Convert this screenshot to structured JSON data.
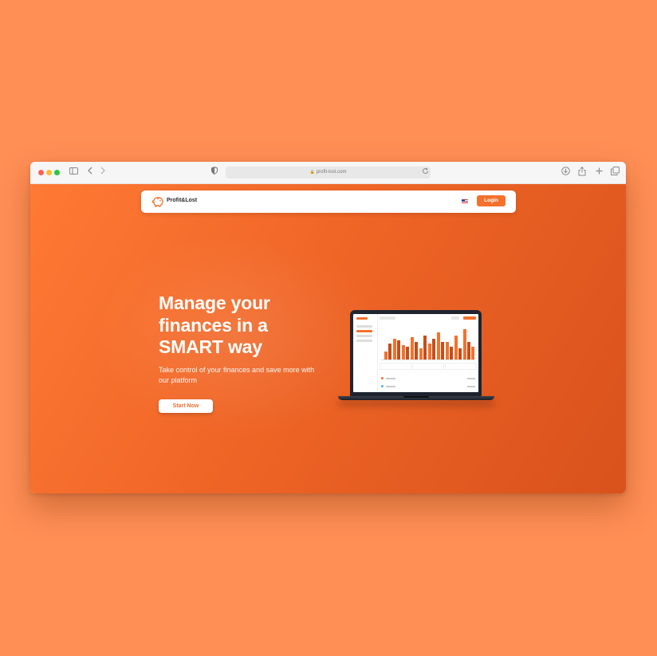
{
  "browser": {
    "url": "profit-lost.com"
  },
  "navbar": {
    "brand": "Profit&Lost",
    "login_label": "Login"
  },
  "hero": {
    "title_line1": "Manage your",
    "title_line2": "finances in a",
    "title_line3": "SMART way",
    "subtitle": "Take control of your finances and save more with our platform",
    "cta_label": "Start Now"
  },
  "colors": {
    "accent": "#f4712d",
    "background": "#ff8f55",
    "hero_gradient_start": "#ff7a35",
    "hero_gradient_end": "#d9521c"
  },
  "icons": {
    "sidebar_toggle": "sidebar-icon",
    "back": "chevron-left-icon",
    "forward": "chevron-right-icon",
    "privacy": "shield-icon",
    "reload": "reload-icon",
    "download": "download-icon",
    "share": "share-icon",
    "new_tab": "plus-icon",
    "tabs": "tabs-icon",
    "language": "us-flag-icon",
    "logo": "piggy-bank-icon"
  }
}
